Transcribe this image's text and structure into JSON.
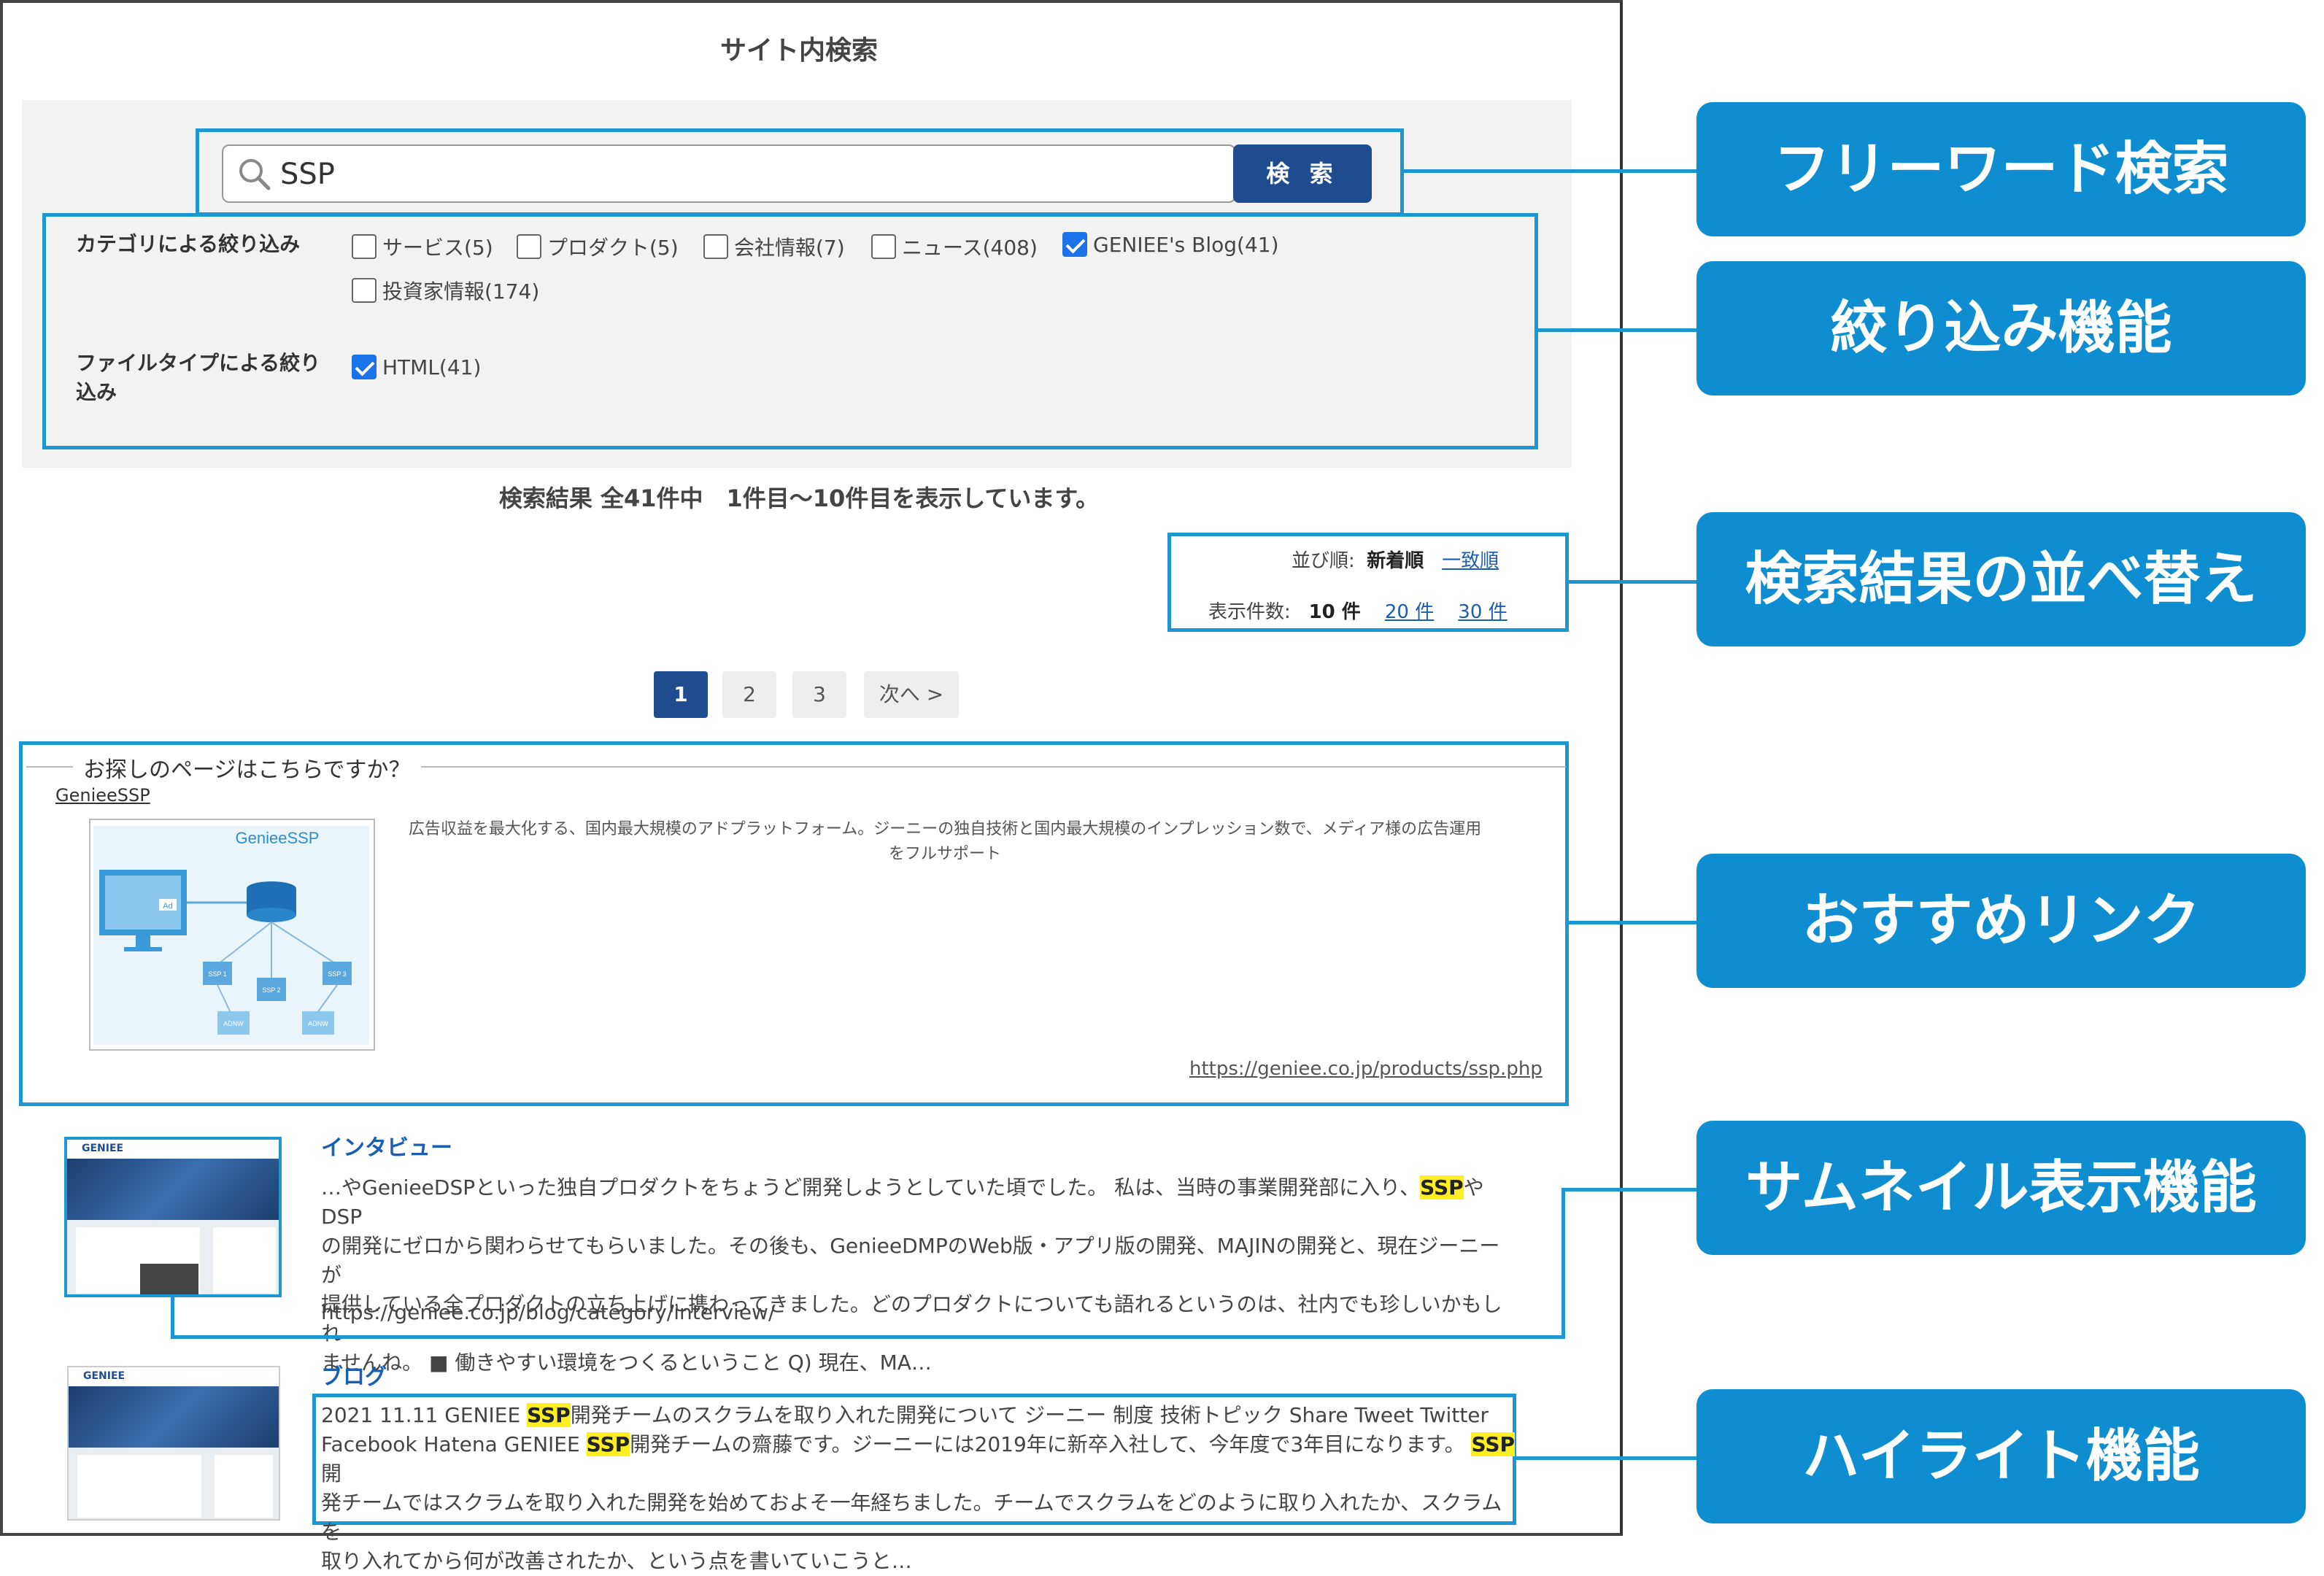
{
  "page": {
    "title": "サイト内検索"
  },
  "search": {
    "value": "SSP",
    "button_label": "検 索"
  },
  "filters": {
    "category_label": "カテゴリによる絞り込み",
    "categories": [
      {
        "label": "サービス(5)",
        "checked": false
      },
      {
        "label": "プロダクト(5)",
        "checked": false
      },
      {
        "label": "会社情報(7)",
        "checked": false
      },
      {
        "label": "ニュース(408)",
        "checked": false
      },
      {
        "label": "GENIEE's Blog(41)",
        "checked": true
      },
      {
        "label": "投資家情報(174)",
        "checked": false
      }
    ],
    "filetype_label_1": "ファイルタイプによる絞り",
    "filetype_label_2": "込み",
    "filetypes": [
      {
        "label": "HTML(41)",
        "checked": true
      }
    ]
  },
  "results_summary": "検索結果 全41件中　1件目〜10件目を表示しています。",
  "sort": {
    "order_label": "並び順:",
    "order_current": "新着順",
    "order_alt": "一致順",
    "count_label": "表示件数:",
    "count_current": "10 件",
    "count_opt1": "20 件",
    "count_opt2": "30 件"
  },
  "pagination": {
    "p1": "1",
    "p2": "2",
    "p3": "3",
    "next": "次へ >"
  },
  "recommend": {
    "legend": "お探しのページはこちらですか？",
    "name": "GenieeSSP",
    "image_title": "GenieeSSP",
    "image_ad": "Ad",
    "ssp1": "SSP 1",
    "ssp2": "SSP 2",
    "ssp3": "SSP 3",
    "adnw1": "ADNW",
    "adnw2": "ADNW",
    "desc_line1": "広告収益を最大化する、国内最大規模のアドプラットフォーム。ジーニーの独自技術と国内最大規模のインプレッション数で、メディア様の広告運用",
    "desc_line2": "をフルサポート",
    "url": "https://geniee.co.jp/products/ssp.php"
  },
  "results": [
    {
      "title": "インタビュー",
      "line1_pre": "…やGenieeDSPといった独自プロダクトをちょうど開発しようとしていた頃でした。 私は、当時の事業開発部に入り、",
      "line1_hl": "SSP",
      "line1_post": "やDSP",
      "line2": "の開発にゼロから関わらせてもらいました。その後も、GenieeDMPのWeb版・アプリ版の開発、MAJINの開発と、現在ジーニーが",
      "line3": "提供している全プロダクトの立ち上げに携わってきました。どのプロダクトについても語れるというのは、社内でも珍しいかもしれ",
      "line4": "ませんね。 ■ 働きやすい環境をつくるということ Q) 現在、MA…",
      "url": "https://geniee.co.jp/blog/category/interview/"
    },
    {
      "title": "ブログ",
      "l1_a": "2021 11.11 GENIEE ",
      "l1_hl": "SSP",
      "l1_b": "開発チームのスクラムを取り入れた開発について ジーニー 制度 技術トピック Share Tweet Twitter",
      "l2_a": "Facebook Hatena GENIEE ",
      "l2_hl": "SSP",
      "l2_b": "開発チームの齋藤です。ジーニーには2019年に新卒入社して、今年度で3年目になります。",
      "l2_hl2": "SSP",
      "l2_c": "開",
      "l3": "発チームではスクラムを取り入れた開発を始めておよそ一年経ちました。チームでスクラムをどのように取り入れたか、スクラムを",
      "l4": "取り入れてから何が改善されたか、という点を書いていこうと…"
    }
  ],
  "callouts": {
    "c1": "フリーワード検索",
    "c2": "絞り込み機能",
    "c3": "検索結果の並べ替え",
    "c4": "おすすめリンク",
    "c5": "サムネイル表示機能",
    "c6": "ハイライト機能"
  },
  "thumbs": {
    "logo": "GENIEE"
  },
  "colors": {
    "accent": "#1e96d2",
    "button": "#1f4c8f",
    "callout": "#0e8ed0",
    "highlight": "#ffee22",
    "link": "#1a5fb4"
  }
}
